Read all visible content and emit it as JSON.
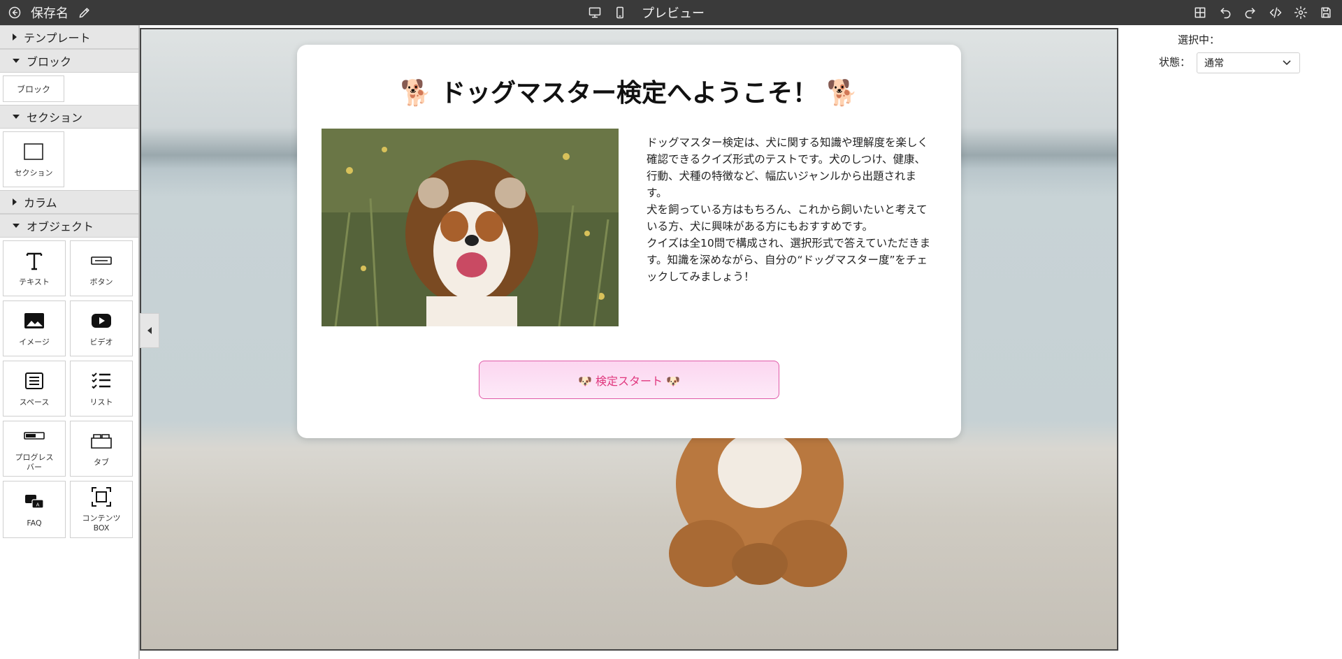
{
  "topbar": {
    "save_name": "保存名",
    "preview_label": "プレビュー",
    "icons": [
      "back-icon",
      "pencil-icon",
      "desktop-icon",
      "mobile-icon",
      "grid-icon",
      "undo-icon",
      "redo-icon",
      "code-icon",
      "gear-icon",
      "save-icon"
    ]
  },
  "leftpanel": {
    "categories": {
      "template": "テンプレート",
      "block": "ブロック",
      "section": "セクション",
      "column": "カラム",
      "object": "オブジェクト"
    },
    "block_item": "ブロック",
    "section_item": "セクション",
    "objects": {
      "text": "テキスト",
      "button": "ボタン",
      "image": "イメージ",
      "video": "ビデオ",
      "space": "スペース",
      "list": "リスト",
      "progress_line1": "プログレス",
      "progress_line2": "バー",
      "tab": "タブ",
      "faq": "FAQ",
      "contents_line1": "コンテンツ",
      "contents_line2": "BOX"
    }
  },
  "card": {
    "title": "🐕 ドッグマスター検定へようこそ！ 🐕",
    "paragraphs": [
      "ドッグマスター検定は、犬に関する知識や理解度を楽しく確認できるクイズ形式のテストです。犬のしつけ、健康、行動、犬種の特徴など、幅広いジャンルから出題されます。",
      "犬を飼っている方はもちろん、これから飼いたいと考えている方、犬に興味がある方にもおすすめです。",
      "クイズは全10問で構成され、選択形式で答えていただきます。知識を深めながら、自分の“ドッグマスター度”をチェックしてみましょう！"
    ],
    "start_button": "🐶 検定スタート 🐶"
  },
  "rightpanel": {
    "selected_label": "選択中：",
    "state_label": "状態：",
    "state_value": "通常"
  },
  "colors": {
    "topbar": "#3a3a3a",
    "button_border": "#e05aa8",
    "button_text": "#e0387e"
  }
}
